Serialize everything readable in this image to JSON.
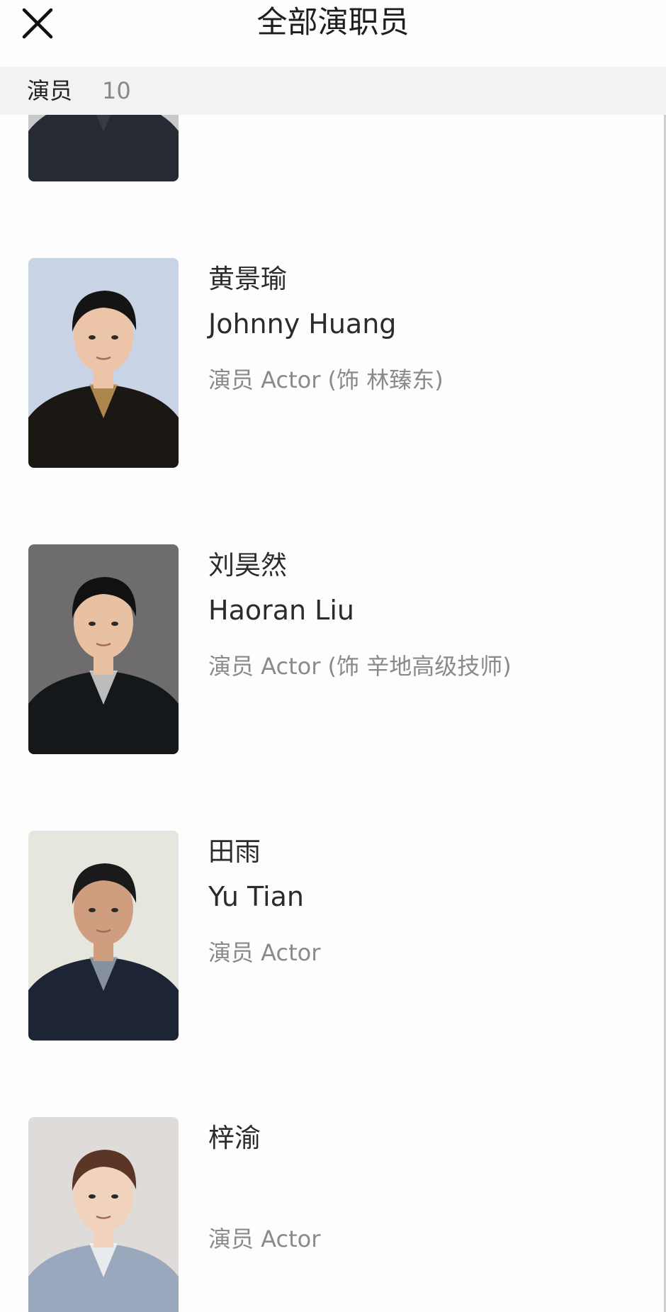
{
  "header": {
    "title": "全部演职员",
    "close_icon": "close-icon"
  },
  "section": {
    "label": "演员",
    "count": "10"
  },
  "cast": [
    {
      "name_cn": "",
      "name_en": "",
      "role": "",
      "photo": {
        "bg": "#c9c9cc",
        "skin": "#e7c3a6",
        "hair": "#1c1c1c",
        "shirt": "#262a33",
        "accent": "#3a3d44"
      }
    },
    {
      "name_cn": "黄景瑜",
      "name_en": "Johnny Huang",
      "role": "演员 Actor (饰 林臻东)",
      "photo": {
        "bg": "#c9d3e6",
        "skin": "#ecc5a8",
        "hair": "#141414",
        "shirt": "#1b1713",
        "accent": "#c69a58"
      }
    },
    {
      "name_cn": "刘昊然",
      "name_en": "Haoran Liu",
      "role": "演员 Actor (饰 辛地高级技师)",
      "photo": {
        "bg": "#6f6c6d",
        "skin": "#e8c1a3",
        "hair": "#111111",
        "shirt": "#15181a",
        "accent": "#d9d9d9"
      }
    },
    {
      "name_cn": "田雨",
      "name_en": "Yu Tian",
      "role": "演员 Actor",
      "photo": {
        "bg": "#e6e6df",
        "skin": "#cf9e7e",
        "hair": "#1a1a1a",
        "shirt": "#1c2436",
        "accent": "#9aa3b0"
      }
    },
    {
      "name_cn": "梓渝",
      "name_en": "",
      "role": "演员 Actor",
      "photo": {
        "bg": "#dedbd8",
        "skin": "#f0d2bd",
        "hair": "#5b3526",
        "shirt": "#9aa8bd",
        "accent": "#f6f6f6"
      }
    }
  ]
}
